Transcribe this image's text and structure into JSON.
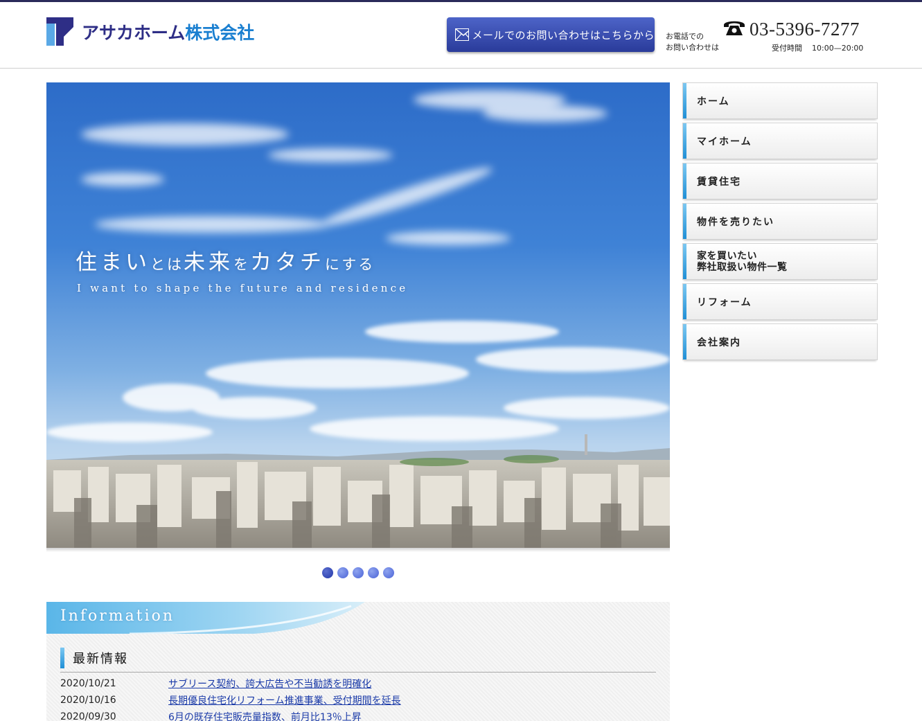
{
  "header": {
    "logo_text_part1": "アサカホーム",
    "logo_text_part2": "株式会社",
    "mail_button_label": "メールでのお問い合わせはこちらから",
    "tel_caption_line1": "お電話での",
    "tel_caption_line2": "お問い合わせは",
    "tel_number": "03-5396-7277",
    "hours_label": "受付時間",
    "hours_value": "10:00—20:00"
  },
  "hero": {
    "title_parts": [
      "住まい",
      "とは",
      "未来",
      "を",
      "カタチ",
      "にする"
    ],
    "subtitle": "I want to shape the future and residence",
    "slide_count": 5,
    "active_slide": 1
  },
  "nav": {
    "items": [
      {
        "label": "ホーム"
      },
      {
        "label": "マイホーム"
      },
      {
        "label": "賃貸住宅"
      },
      {
        "label": "物件を売りたい"
      },
      {
        "label_line1": "家を買いたい",
        "label_line2": "弊社取扱い物件一覧"
      },
      {
        "label": "リフォーム"
      },
      {
        "label": "会社案内"
      }
    ]
  },
  "information": {
    "banner_title": "Information",
    "news_heading": "最新情報",
    "news": [
      {
        "date": "2020/10/21",
        "title": "サブリース契約、誇大広告や不当勧誘を明確化"
      },
      {
        "date": "2020/10/16",
        "title": "長期優良住宅化リフォーム推進事業、受付期間を延長"
      },
      {
        "date": "2020/09/30",
        "title": "6月の既存住宅販売量指数、前月比13％上昇"
      }
    ]
  },
  "colors": {
    "brand_navy": "#2e2e86",
    "brand_blue": "#1a7fd0",
    "button_blue": "#2a3b9a",
    "accent_sky": "#1f8fd6",
    "link_blue": "#1a3aa8"
  }
}
